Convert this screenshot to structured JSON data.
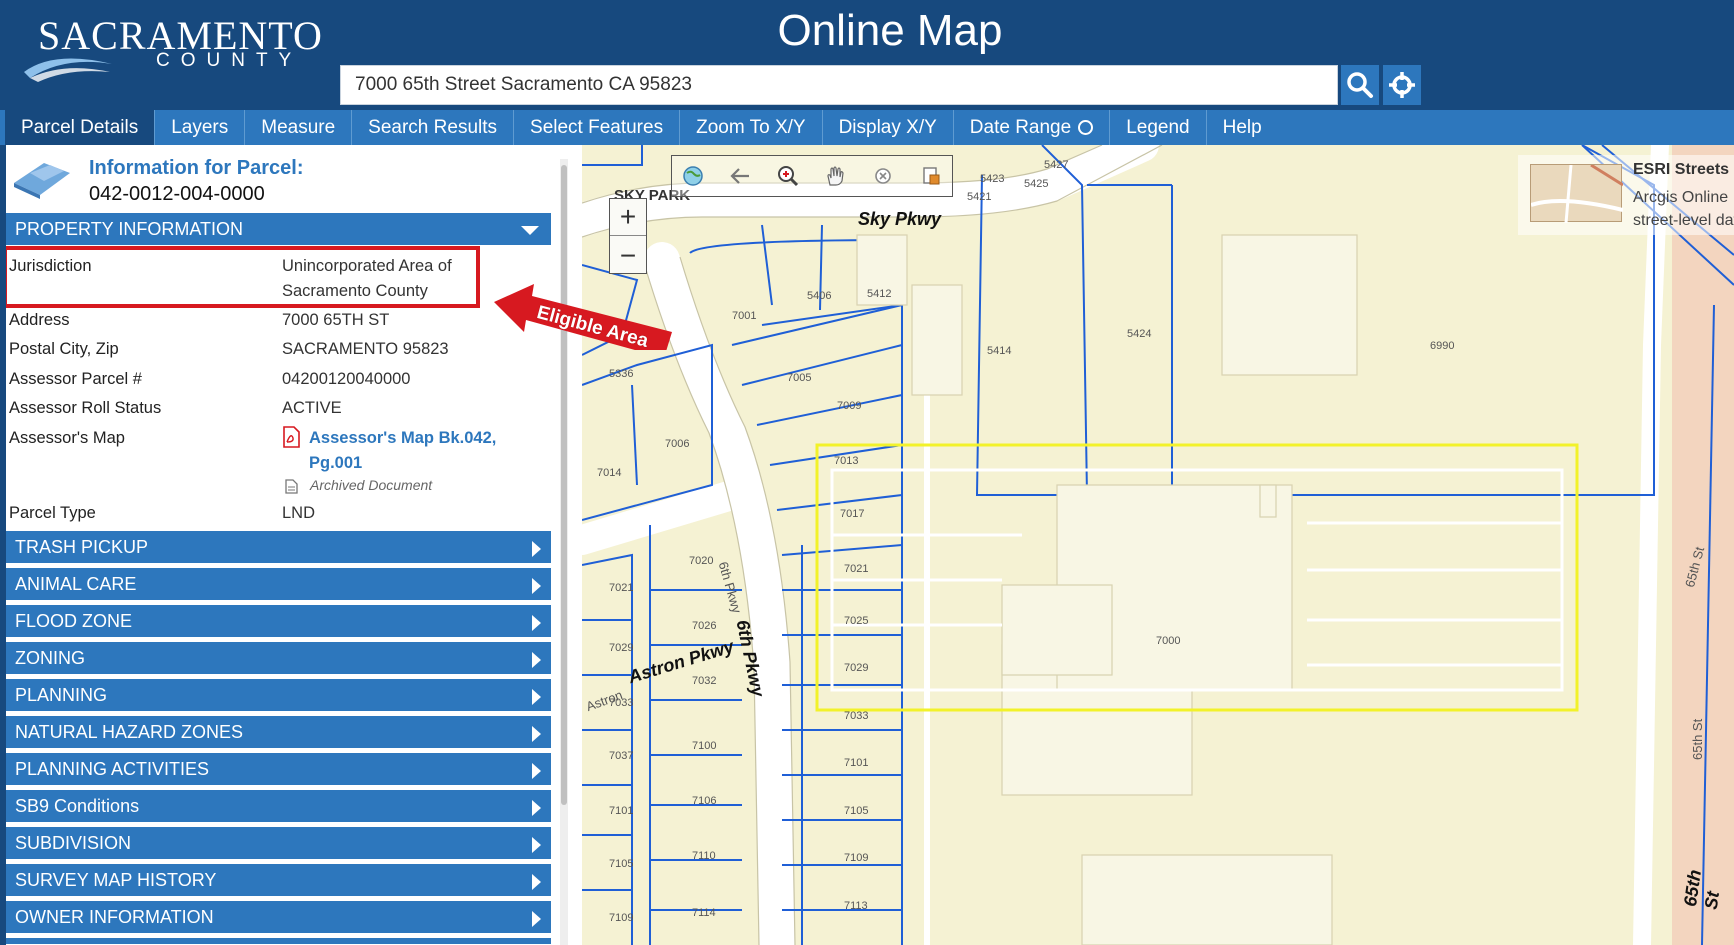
{
  "header": {
    "logo_main": "SACRAMENTO",
    "logo_sub": "COUNTY",
    "title": "Online Map",
    "search_value": "7000 65th Street Sacramento CA 95823"
  },
  "nav": {
    "items": [
      "Parcel Details",
      "Layers",
      "Measure",
      "Search Results",
      "Select Features",
      "Zoom To X/Y",
      "Display X/Y",
      "Date Range",
      "Legend",
      "Help"
    ]
  },
  "panel": {
    "title": "Information for Parcel:",
    "parcel_id": "042-0012-004-0000",
    "property_header": "PROPERTY INFORMATION",
    "fields": {
      "jurisdiction_label": "Jurisdiction",
      "jurisdiction_value": "Unincorporated Area of Sacramento County",
      "address_label": "Address",
      "address_value": "7000 65TH ST",
      "city_label": "Postal City, Zip",
      "city_value": "SACRAMENTO 95823",
      "apn_label": "Assessor Parcel #",
      "apn_value": "04200120040000",
      "roll_label": "Assessor Roll Status",
      "roll_value": "ACTIVE",
      "map_label": "Assessor's Map",
      "map_value": "Assessor's Map Bk.042, Pg.001",
      "archived_label": "Archived Document",
      "type_label": "Parcel Type",
      "type_value": "LND"
    },
    "sections": [
      "TRASH PICKUP",
      "ANIMAL CARE",
      "FLOOD ZONE",
      "ZONING",
      "PLANNING",
      "NATURAL HAZARD ZONES",
      "PLANNING ACTIVITIES",
      "SB9 Conditions",
      "SUBDIVISION",
      "SURVEY MAP HISTORY",
      "OWNER INFORMATION"
    ]
  },
  "callout": {
    "text": "Eligible Area"
  },
  "map": {
    "zoom_in": "+",
    "zoom_out": "−",
    "streets": {
      "sky_park": "SKY PARK",
      "sky_pkwy": "Sky Pkwy",
      "astron_pkwy": "Astron Pkwy",
      "astron_small": "Astron",
      "sixth_pkwy": "6th Pkwy",
      "sixth_pkwy_small": "6th Pkwy",
      "sixty_fifth": "65th St",
      "sixty_fifth_small": "65th St"
    },
    "parcels": [
      "5406",
      "5412",
      "5414",
      "5424",
      "6990",
      "7001",
      "7005",
      "7009",
      "7013",
      "7017",
      "7021",
      "7025",
      "7029",
      "7033",
      "7101",
      "7105",
      "7109",
      "7113",
      "5336",
      "7006",
      "7014",
      "7020",
      "7026",
      "7032",
      "7100",
      "7106",
      "7110",
      "7114",
      "7021",
      "7029",
      "7033",
      "7037",
      "7101",
      "7105",
      "7109",
      "7000",
      "5423",
      "5421",
      "5425",
      "5427"
    ],
    "basemap_title": "ESRI Streets",
    "basemap_desc_1": "Arcgis Online",
    "basemap_desc_2": "street-level data"
  },
  "colors": {
    "header_bg": "#17497e",
    "nav_bg": "#2d77bd",
    "highlight": "#d71920",
    "parcel_line": "#1f5fd6",
    "selected_parcel": "#f2f22a",
    "map_bg": "#f5f2d3"
  }
}
